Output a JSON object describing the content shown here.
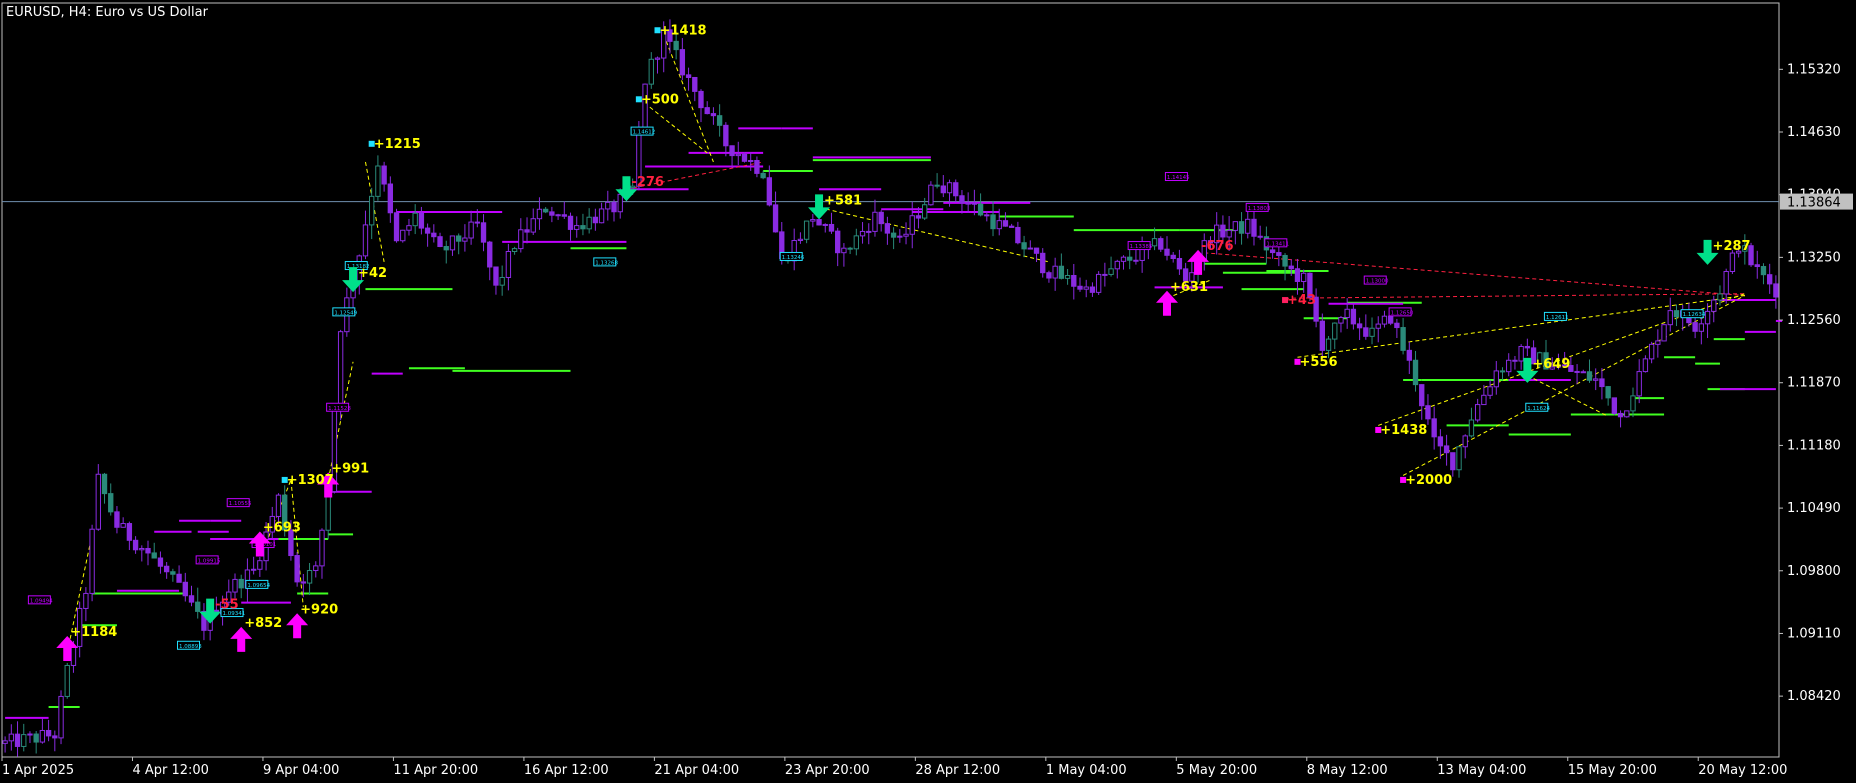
{
  "window": {
    "title": "EURUSD, H4:  Euro vs US Dollar"
  },
  "colors": {
    "background": "#000000",
    "frame": "#c0c0c0",
    "text": "#ffffff",
    "candle": "#8a2be2",
    "candle_alt": "#2a8a7a",
    "up_arrow": "#ff00ff",
    "down_arrow": "#00e08a",
    "level_magenta": "#c000ff",
    "level_green": "#40ff20",
    "label_yellow": "#ffff00",
    "label_red": "#ff2040",
    "dash_yellow": "#ffff00",
    "dash_red": "#ff3030",
    "current_price_line": "#7090b0",
    "current_price_box": "#c0c0c0"
  },
  "chart_data": {
    "type": "candlestick",
    "symbol": "EURUSD",
    "timeframe": "H4",
    "description": "Euro vs US Dollar",
    "current_price": "1.13864",
    "y_ticks": [
      "1.15320",
      "1.14630",
      "1.13940",
      "1.13250",
      "1.12560",
      "1.11870",
      "1.11180",
      "1.10490",
      "1.09800",
      "1.09110",
      "1.08420"
    ],
    "y_tick_values": [
      1.1532,
      1.1463,
      1.1394,
      1.1325,
      1.1256,
      1.1187,
      1.1118,
      1.1049,
      1.098,
      1.0911,
      1.0842
    ],
    "ylim": [
      1.0775,
      1.1605
    ],
    "x_ticks": [
      "1 Apr 2025",
      "4 Apr 12:00",
      "9 Apr 04:00",
      "11 Apr 20:00",
      "16 Apr 12:00",
      "21 Apr 04:00",
      "23 Apr 20:00",
      "28 Apr 12:00",
      "1 May 04:00",
      "5 May 20:00",
      "8 May 12:00",
      "13 May 04:00",
      "15 May 20:00",
      "20 May 12:00"
    ],
    "x_tick_index": [
      0,
      21,
      42,
      63,
      84,
      105,
      126,
      147,
      168,
      189,
      210,
      231,
      252,
      273
    ],
    "bar_count": 286,
    "anchors": [
      [
        0,
        1.079
      ],
      [
        8,
        1.08
      ],
      [
        10,
        1.087
      ],
      [
        13,
        1.096
      ],
      [
        15,
        1.108
      ],
      [
        18,
        1.103
      ],
      [
        23,
        1.1
      ],
      [
        28,
        1.096
      ],
      [
        32,
        1.092
      ],
      [
        36,
        1.096
      ],
      [
        40,
        1.098
      ],
      [
        44,
        1.106
      ],
      [
        47,
        1.097
      ],
      [
        50,
        1.098
      ],
      [
        52,
        1.107
      ],
      [
        54,
        1.125
      ],
      [
        57,
        1.133
      ],
      [
        60,
        1.143
      ],
      [
        63,
        1.134
      ],
      [
        66,
        1.137
      ],
      [
        70,
        1.133
      ],
      [
        76,
        1.136
      ],
      [
        79,
        1.129
      ],
      [
        82,
        1.134
      ],
      [
        87,
        1.138
      ],
      [
        92,
        1.136
      ],
      [
        98,
        1.138
      ],
      [
        101,
        1.14
      ],
      [
        103,
        1.152
      ],
      [
        106,
        1.157
      ],
      [
        110,
        1.152
      ],
      [
        116,
        1.145
      ],
      [
        122,
        1.142
      ],
      [
        125,
        1.132
      ],
      [
        130,
        1.137
      ],
      [
        135,
        1.133
      ],
      [
        140,
        1.137
      ],
      [
        144,
        1.134
      ],
      [
        150,
        1.141
      ],
      [
        156,
        1.138
      ],
      [
        162,
        1.135
      ],
      [
        168,
        1.131
      ],
      [
        174,
        1.129
      ],
      [
        180,
        1.132
      ],
      [
        186,
        1.134
      ],
      [
        190,
        1.13
      ],
      [
        194,
        1.135
      ],
      [
        200,
        1.136
      ],
      [
        205,
        1.132
      ],
      [
        209,
        1.13
      ],
      [
        212,
        1.123
      ],
      [
        216,
        1.126
      ],
      [
        220,
        1.124
      ],
      [
        223,
        1.126
      ],
      [
        227,
        1.119
      ],
      [
        230,
        1.112
      ],
      [
        233,
        1.11
      ],
      [
        236,
        1.115
      ],
      [
        240,
        1.12
      ],
      [
        244,
        1.122
      ],
      [
        248,
        1.121
      ],
      [
        252,
        1.12
      ],
      [
        256,
        1.119
      ],
      [
        260,
        1.115
      ],
      [
        264,
        1.121
      ],
      [
        268,
        1.127
      ],
      [
        272,
        1.125
      ],
      [
        276,
        1.129
      ],
      [
        279,
        1.134
      ],
      [
        282,
        1.131
      ],
      [
        285,
        1.129
      ]
    ],
    "signals": [
      {
        "type": "up",
        "bar": 10,
        "price": 1.0895,
        "label": "+1184"
      },
      {
        "type": "down",
        "bar": 33,
        "price": 1.0935,
        "label": "-55"
      },
      {
        "type": "up",
        "bar": 38,
        "price": 1.0905,
        "label": "+852"
      },
      {
        "type": "up",
        "bar": 41,
        "price": 1.101,
        "label": "+693"
      },
      {
        "type": "up",
        "bar": 47,
        "price": 1.092,
        "label": "+920"
      },
      {
        "type": "up",
        "bar": 52,
        "price": 1.1075,
        "label": "+991"
      },
      {
        "type": "down",
        "bar": 56,
        "price": 1.13,
        "label": "+42"
      },
      {
        "type": "down",
        "bar": 100,
        "price": 1.14,
        "label": "-276"
      },
      {
        "type": "down",
        "bar": 131,
        "price": 1.138,
        "label": "+581"
      },
      {
        "type": "up",
        "bar": 187,
        "price": 1.1275,
        "label": "+631"
      },
      {
        "type": "up",
        "bar": 192,
        "price": 1.132,
        "label": "-676"
      },
      {
        "type": "down",
        "bar": 245,
        "price": 1.12,
        "label": "+649"
      },
      {
        "type": "down",
        "bar": 274,
        "price": 1.133,
        "label": "+287"
      }
    ],
    "profit_labels": [
      {
        "bar": 59,
        "price": 1.145,
        "label": "+1215",
        "color": "yellow"
      },
      {
        "bar": 45,
        "price": 1.108,
        "label": "+1307",
        "color": "yellow"
      },
      {
        "bar": 102,
        "price": 1.1499,
        "label": "+500",
        "color": "yellow"
      },
      {
        "bar": 105,
        "price": 1.1575,
        "label": "+1418",
        "color": "yellow"
      },
      {
        "bar": 206,
        "price": 1.1278,
        "label": "+43",
        "color": "red"
      },
      {
        "bar": 208,
        "price": 1.121,
        "label": "+556",
        "color": "yellow"
      },
      {
        "bar": 221,
        "price": 1.1135,
        "label": "+1438",
        "color": "yellow"
      },
      {
        "bar": 225,
        "price": 1.108,
        "label": "+2000",
        "color": "yellow"
      }
    ],
    "level_lines": [
      {
        "from": 0,
        "to": 7,
        "price": 1.0818,
        "color": "magenta"
      },
      {
        "from": 7,
        "to": 12,
        "price": 1.083,
        "color": "green"
      },
      {
        "from": 12,
        "to": 18,
        "price": 1.092,
        "color": "green"
      },
      {
        "from": 14,
        "to": 29,
        "price": 1.0955,
        "color": "green"
      },
      {
        "from": 18,
        "to": 28,
        "price": 1.0958,
        "color": "magenta"
      },
      {
        "from": 28,
        "to": 33,
        "price": 1.1035,
        "color": "magenta"
      },
      {
        "from": 33,
        "to": 38,
        "price": 1.1035,
        "color": "magenta"
      },
      {
        "from": 33,
        "to": 44,
        "price": 1.1015,
        "color": "magenta"
      },
      {
        "from": 44,
        "to": 52,
        "price": 1.1015,
        "color": "green"
      },
      {
        "from": 52,
        "to": 56,
        "price": 1.102,
        "color": "green"
      },
      {
        "from": 52,
        "to": 59,
        "price": 1.1067,
        "color": "magenta"
      },
      {
        "from": 47,
        "to": 52,
        "price": 1.0955,
        "color": "green"
      },
      {
        "from": 38,
        "to": 46,
        "price": 1.0945,
        "color": "magenta"
      },
      {
        "from": 58,
        "to": 72,
        "price": 1.129,
        "color": "green"
      },
      {
        "from": 59,
        "to": 64,
        "price": 1.1197,
        "color": "magenta"
      },
      {
        "from": 72,
        "to": 91,
        "price": 1.12,
        "color": "green"
      },
      {
        "from": 63,
        "to": 80,
        "price": 1.1375,
        "color": "magenta"
      },
      {
        "from": 80,
        "to": 100,
        "price": 1.1342,
        "color": "magenta"
      },
      {
        "from": 91,
        "to": 100,
        "price": 1.1335,
        "color": "green"
      },
      {
        "from": 100,
        "to": 110,
        "price": 1.14,
        "color": "magenta"
      },
      {
        "from": 103,
        "to": 122,
        "price": 1.1425,
        "color": "magenta"
      },
      {
        "from": 110,
        "to": 122,
        "price": 1.144,
        "color": "magenta"
      },
      {
        "from": 122,
        "to": 130,
        "price": 1.142,
        "color": "green"
      },
      {
        "from": 118,
        "to": 125,
        "price": 1.1467,
        "color": "magenta"
      },
      {
        "from": 125,
        "to": 130,
        "price": 1.1467,
        "color": "magenta"
      },
      {
        "from": 130,
        "to": 149,
        "price": 1.1432,
        "color": "green"
      },
      {
        "from": 130,
        "to": 149,
        "price": 1.1435,
        "color": "magenta"
      },
      {
        "from": 131,
        "to": 141,
        "price": 1.14,
        "color": "magenta"
      },
      {
        "from": 141,
        "to": 151,
        "price": 1.1378,
        "color": "magenta"
      },
      {
        "from": 151,
        "to": 165,
        "price": 1.1385,
        "color": "magenta"
      },
      {
        "from": 146,
        "to": 160,
        "price": 1.1375,
        "color": "magenta"
      },
      {
        "from": 160,
        "to": 172,
        "price": 1.137,
        "color": "green"
      },
      {
        "from": 172,
        "to": 189,
        "price": 1.1355,
        "color": "green"
      },
      {
        "from": 189,
        "to": 198,
        "price": 1.1355,
        "color": "green"
      },
      {
        "from": 185,
        "to": 196,
        "price": 1.1292,
        "color": "magenta"
      },
      {
        "from": 196,
        "to": 208,
        "price": 1.1308,
        "color": "green"
      },
      {
        "from": 193,
        "to": 203,
        "price": 1.1318,
        "color": "green"
      },
      {
        "from": 203,
        "to": 213,
        "price": 1.131,
        "color": "green"
      },
      {
        "from": 199,
        "to": 209,
        "price": 1.129,
        "color": "green"
      },
      {
        "from": 209,
        "to": 216,
        "price": 1.1258,
        "color": "green"
      },
      {
        "from": 216,
        "to": 228,
        "price": 1.1275,
        "color": "green"
      },
      {
        "from": 213,
        "to": 225,
        "price": 1.1274,
        "color": "magenta"
      },
      {
        "from": 225,
        "to": 228,
        "price": 1.119,
        "color": "green"
      },
      {
        "from": 228,
        "to": 242,
        "price": 1.119,
        "color": "green"
      },
      {
        "from": 242,
        "to": 252,
        "price": 1.119,
        "color": "magenta"
      },
      {
        "from": 232,
        "to": 242,
        "price": 1.114,
        "color": "green"
      },
      {
        "from": 242,
        "to": 252,
        "price": 1.113,
        "color": "green"
      },
      {
        "from": 252,
        "to": 259,
        "price": 1.1152,
        "color": "green"
      },
      {
        "from": 259,
        "to": 267,
        "price": 1.1152,
        "color": "green"
      },
      {
        "from": 262,
        "to": 267,
        "price": 1.117,
        "color": "green"
      },
      {
        "from": 267,
        "to": 272,
        "price": 1.1215,
        "color": "green"
      },
      {
        "from": 272,
        "to": 276,
        "price": 1.1208,
        "color": "green"
      },
      {
        "from": 274,
        "to": 280,
        "price": 1.118,
        "color": "green"
      },
      {
        "from": 276,
        "to": 285,
        "price": 1.118,
        "color": "magenta"
      },
      {
        "from": 276,
        "to": 286,
        "price": 1.1278,
        "color": "magenta"
      },
      {
        "from": 275,
        "to": 280,
        "price": 1.1235,
        "color": "green"
      },
      {
        "from": 280,
        "to": 285,
        "price": 1.1243,
        "color": "magenta"
      },
      {
        "from": 286,
        "to": 290,
        "price": 1.1255,
        "color": "magenta"
      },
      {
        "from": 24,
        "to": 30,
        "price": 1.1023,
        "color": "magenta"
      },
      {
        "from": 31,
        "to": 36,
        "price": 1.1023,
        "color": "magenta"
      },
      {
        "from": 65,
        "to": 74,
        "price": 1.1203,
        "color": "green"
      }
    ],
    "price_tags": [
      {
        "bar": 6,
        "price": 1.0948,
        "text": "1.09494",
        "color": "magenta"
      },
      {
        "bar": 30,
        "price": 1.0898,
        "text": "1.08893",
        "color": "cyan"
      },
      {
        "bar": 33,
        "price": 1.0992,
        "text": "1.09915",
        "color": "magenta"
      },
      {
        "bar": 37,
        "price": 1.0934,
        "text": "1.09341",
        "color": "cyan"
      },
      {
        "bar": 38,
        "price": 1.1055,
        "text": "1.10555",
        "color": "magenta"
      },
      {
        "bar": 41,
        "price": 1.0965,
        "text": "1.09654",
        "color": "cyan"
      },
      {
        "bar": 42,
        "price": 1.101,
        "text": "1.10101",
        "color": "magenta"
      },
      {
        "bar": 54,
        "price": 1.116,
        "text": "1.11528",
        "color": "magenta"
      },
      {
        "bar": 55,
        "price": 1.1265,
        "text": "1.12549",
        "color": "cyan"
      },
      {
        "bar": 57,
        "price": 1.1316,
        "text": "1.13182",
        "color": "cyan"
      },
      {
        "bar": 97,
        "price": 1.132,
        "text": "1.13268",
        "color": "cyan"
      },
      {
        "bar": 103,
        "price": 1.1464,
        "text": "1.14612",
        "color": "cyan"
      },
      {
        "bar": 127,
        "price": 1.1326,
        "text": "1.13246",
        "color": "cyan"
      },
      {
        "bar": 189,
        "price": 1.1414,
        "text": "1.14145",
        "color": "magenta"
      },
      {
        "bar": 183,
        "price": 1.1338,
        "text": "1.13385",
        "color": "magenta"
      },
      {
        "bar": 202,
        "price": 1.138,
        "text": "1.13803",
        "color": "magenta"
      },
      {
        "bar": 205,
        "price": 1.1341,
        "text": "1.13411",
        "color": "magenta"
      },
      {
        "bar": 221,
        "price": 1.13,
        "text": "1.13000",
        "color": "magenta"
      },
      {
        "bar": 225,
        "price": 1.1265,
        "text": "1.12650",
        "color": "magenta"
      },
      {
        "bar": 247,
        "price": 1.116,
        "text": "1.11624",
        "color": "cyan"
      },
      {
        "bar": 250,
        "price": 1.126,
        "text": "1.12611",
        "color": "cyan"
      },
      {
        "bar": 272,
        "price": 1.1263,
        "text": "1.12634",
        "color": "cyan"
      }
    ],
    "dashed_lines": [
      {
        "from_bar": 10,
        "from_price": 1.089,
        "to_bar": 14,
        "to_price": 1.102,
        "color": "yellow"
      },
      {
        "from_bar": 42,
        "from_price": 1.101,
        "to_bar": 46,
        "to_price": 1.108,
        "color": "yellow"
      },
      {
        "from_bar": 46,
        "from_price": 1.108,
        "to_bar": 48,
        "to_price": 1.094,
        "color": "yellow"
      },
      {
        "from_bar": 52,
        "from_price": 1.108,
        "to_bar": 56,
        "to_price": 1.121,
        "color": "yellow"
      },
      {
        "from_bar": 58,
        "from_price": 1.143,
        "to_bar": 61,
        "to_price": 1.132,
        "color": "yellow"
      },
      {
        "from_bar": 102,
        "from_price": 1.15,
        "to_bar": 113,
        "to_price": 1.144,
        "color": "yellow"
      },
      {
        "from_bar": 106,
        "from_price": 1.157,
        "to_bar": 114,
        "to_price": 1.143,
        "color": "yellow"
      },
      {
        "from_bar": 100,
        "from_price": 1.14,
        "to_bar": 122,
        "to_price": 1.143,
        "color": "red"
      },
      {
        "from_bar": 131,
        "from_price": 1.138,
        "to_bar": 168,
        "to_price": 1.132,
        "color": "yellow"
      },
      {
        "from_bar": 187,
        "from_price": 1.128,
        "to_bar": 194,
        "to_price": 1.13,
        "color": "yellow"
      },
      {
        "from_bar": 193,
        "from_price": 1.133,
        "to_bar": 280,
        "to_price": 1.1283,
        "color": "red"
      },
      {
        "from_bar": 206,
        "from_price": 1.128,
        "to_bar": 280,
        "to_price": 1.1285,
        "color": "red"
      },
      {
        "from_bar": 208,
        "from_price": 1.1215,
        "to_bar": 280,
        "to_price": 1.1283,
        "color": "yellow"
      },
      {
        "from_bar": 221,
        "from_price": 1.114,
        "to_bar": 280,
        "to_price": 1.1285,
        "color": "yellow"
      },
      {
        "from_bar": 225,
        "from_price": 1.1085,
        "to_bar": 280,
        "to_price": 1.1283,
        "color": "yellow"
      },
      {
        "from_bar": 245,
        "from_price": 1.1195,
        "to_bar": 258,
        "to_price": 1.115,
        "color": "yellow"
      }
    ]
  }
}
